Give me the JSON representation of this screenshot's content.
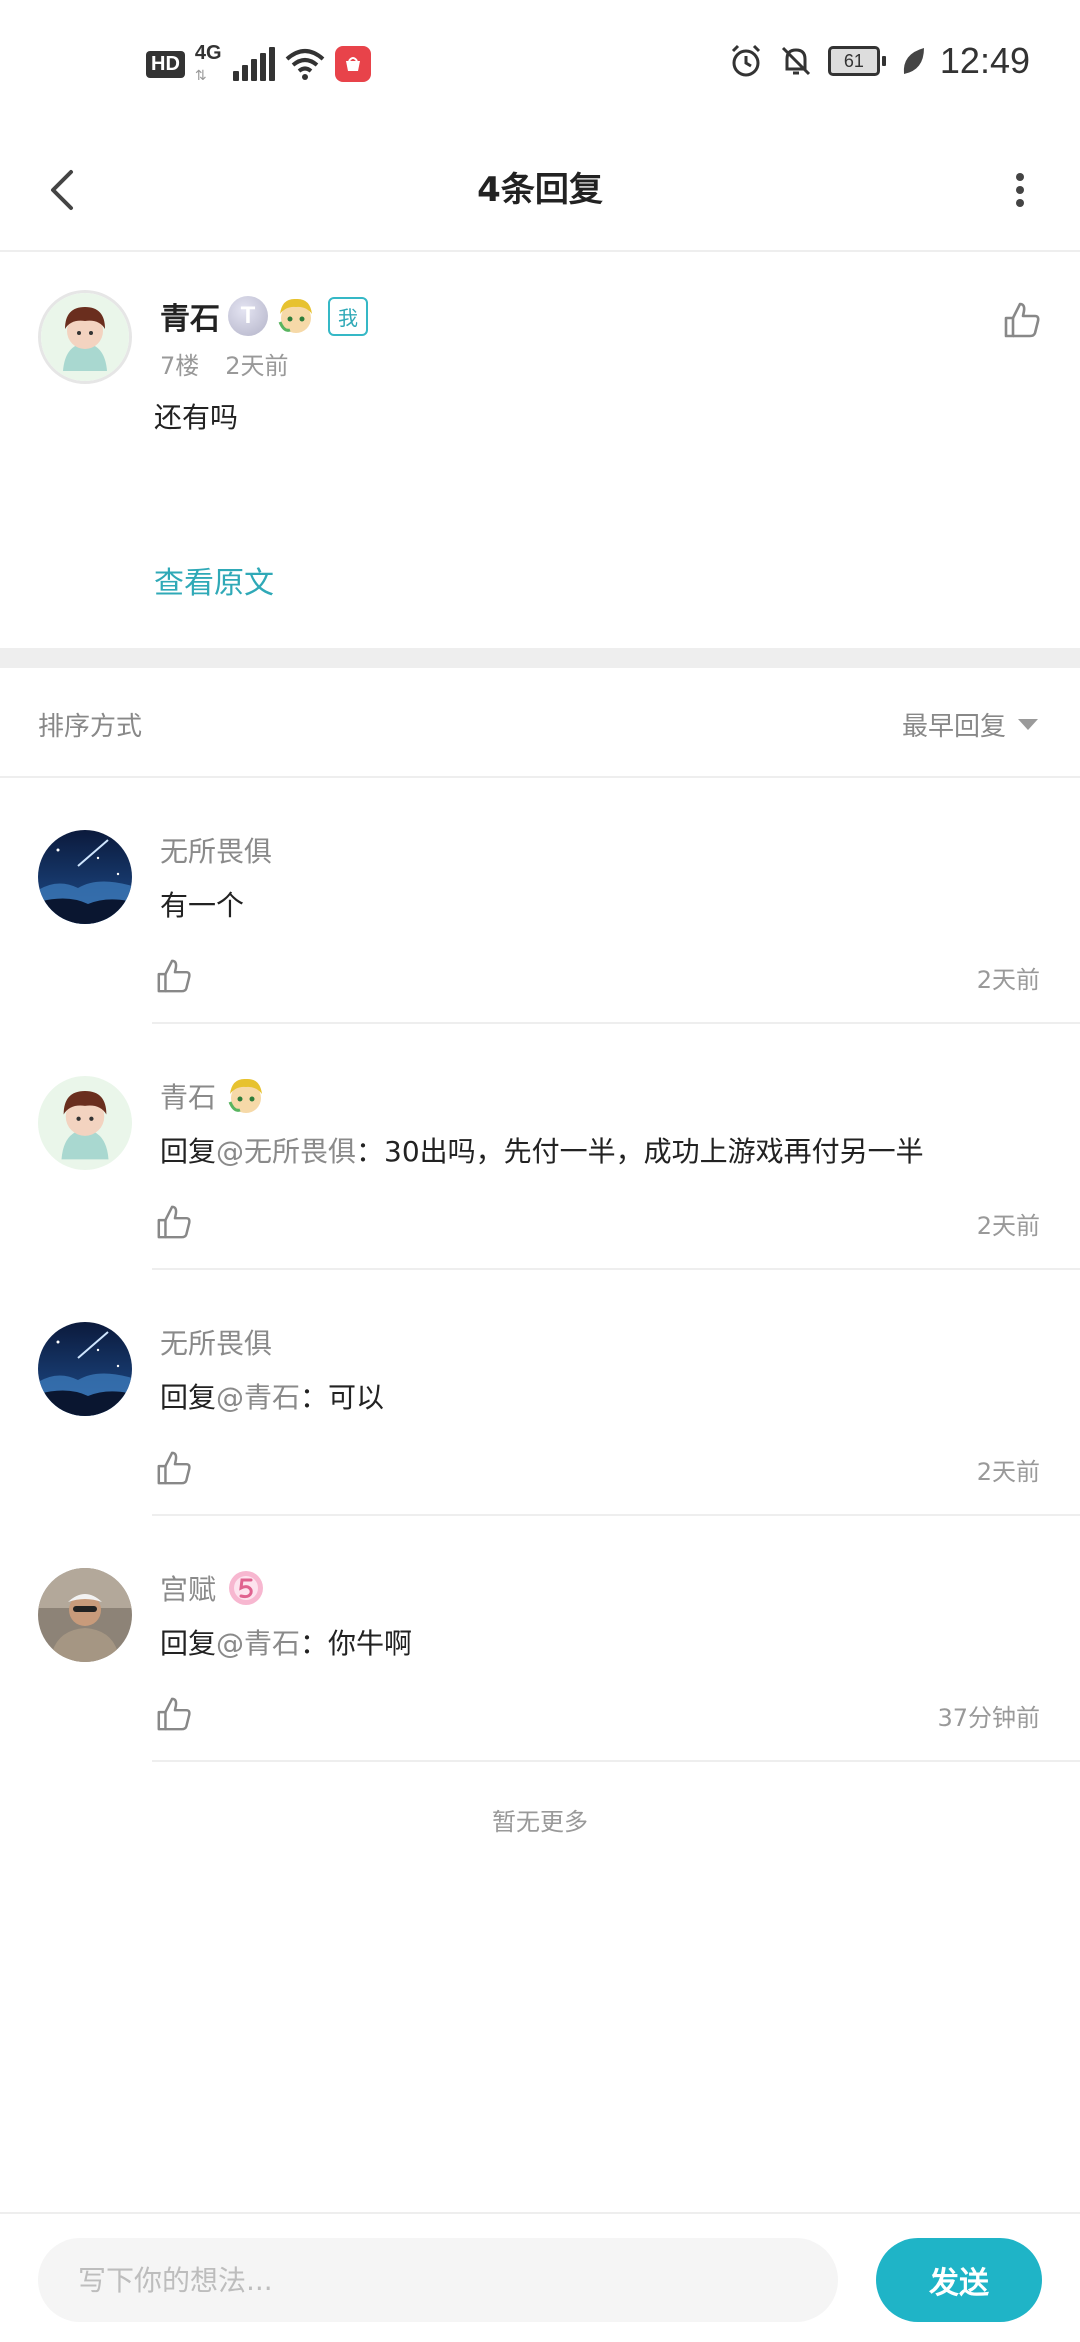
{
  "status_bar": {
    "hd": "HD",
    "network": "4G",
    "battery": "61",
    "time": "12:49"
  },
  "header": {
    "title": "4条回复"
  },
  "main_post": {
    "name": "青石",
    "level": "T",
    "me_badge": "我",
    "floor": "7楼",
    "time": "2天前",
    "text": "还有吗",
    "view_original": "查看原文"
  },
  "sort": {
    "label": "排序方式",
    "value": "最早回复"
  },
  "replies": [
    {
      "name": "无所畏俱",
      "prefix": "",
      "mention": "",
      "text": "有一个",
      "time": "2天前",
      "avatar": "starry-night"
    },
    {
      "name": "青石",
      "prefix": "回复",
      "mention": "@无所畏俱",
      "text": "：30出吗，先付一半，成功上游戏再付另一半",
      "time": "2天前",
      "avatar": "cartoon-boy"
    },
    {
      "name": "无所畏俱",
      "prefix": "回复",
      "mention": "@青石",
      "text": "：可以",
      "time": "2天前",
      "avatar": "starry-night"
    },
    {
      "name": "宫赋",
      "prefix": "回复",
      "mention": "@青石",
      "text": "：你牛啊",
      "time": "37分钟前",
      "avatar": "man-photo"
    }
  ],
  "no_more": "暂无更多",
  "footer": {
    "placeholder": "写下你的想法...",
    "send": "发送"
  },
  "colors": {
    "accent": "#1fb4c7",
    "link": "#2fa9b7",
    "muted": "#999999"
  }
}
